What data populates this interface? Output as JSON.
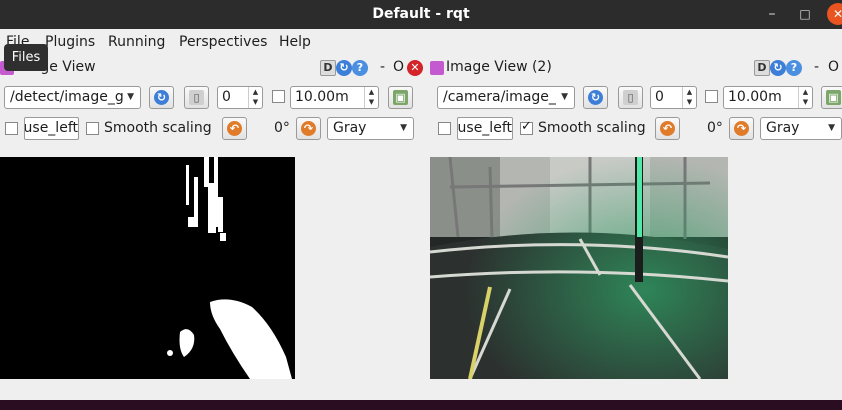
{
  "window": {
    "title": "Default - rqt",
    "minimize": "–",
    "maximize": "□",
    "close": "✕"
  },
  "menu": {
    "items": [
      "File",
      "Plugins",
      "Running",
      "Perspectives",
      "Help"
    ]
  },
  "tooltip": "Files",
  "panels": [
    {
      "title": "Image View",
      "help_d": "D",
      "help_minus": "-",
      "help_o": "O",
      "topic": "/detect/image_g",
      "spin_value": "0",
      "max_value": "10.00m",
      "left_field": "use_left",
      "smooth_label": "Smooth scaling",
      "smooth_checked": false,
      "rotation": "0°",
      "color_mode": "Gray"
    },
    {
      "title": "Image View (2)",
      "help_d": "D",
      "help_minus": "-",
      "help_o": "O",
      "topic": "/camera/image_",
      "spin_value": "0",
      "max_value": "10.00m",
      "left_field": "use_left",
      "smooth_label": "Smooth scaling",
      "smooth_checked": true,
      "rotation": "0°",
      "color_mode": "Gray"
    }
  ],
  "colors": {
    "titlebar": "#2c2c2c",
    "close": "#e95420",
    "taskbar": "#2a0d20"
  }
}
